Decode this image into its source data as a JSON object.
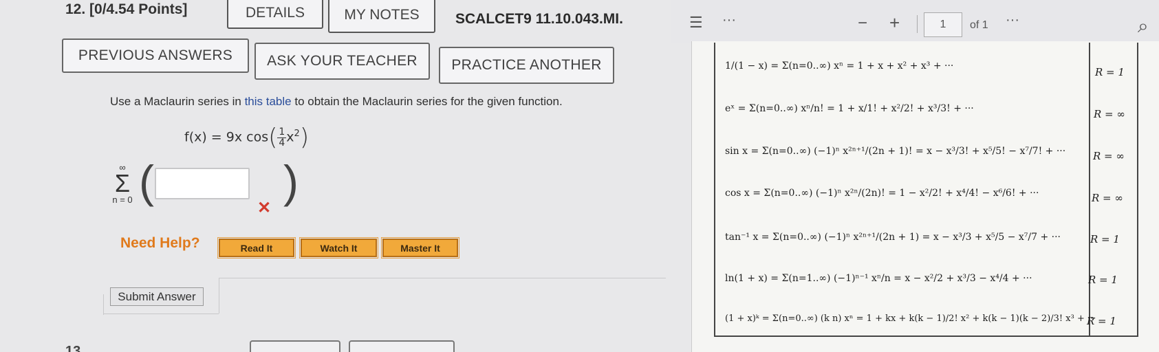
{
  "question": {
    "number_points": "12. [0/4.54 Points]",
    "id": "SCALCET9 11.10.043.MI.",
    "prompt_pre": "Use a Maclaurin series in ",
    "prompt_link": "this table",
    "prompt_post": " to obtain the Maclaurin series for the given function.",
    "function_lhs": "f(x) = 9x cos",
    "function_frac_num": "1",
    "function_frac_den": "4",
    "function_tail": "x",
    "function_exp": "2",
    "sum_upper": "∞",
    "sum_symbol": "Σ",
    "sum_lower": "n = 0",
    "answer_value": "",
    "wrong_mark": "✕"
  },
  "tabs": {
    "details": "DETAILS",
    "my_notes": "MY NOTES"
  },
  "actions": {
    "previous_answers": "PREVIOUS ANSWERS",
    "ask_teacher": "ASK YOUR TEACHER",
    "practice_another": "PRACTICE ANOTHER"
  },
  "help": {
    "label": "Need Help?",
    "read_it": "Read It",
    "watch_it": "Watch It",
    "master_it": "Master It"
  },
  "submit_label": "Submit Answer",
  "viewer": {
    "list_icon": "☰",
    "more_left": "···",
    "zoom_out": "−",
    "zoom_in": "+",
    "page_current": "1",
    "page_total": "of 1",
    "more_right": "···",
    "search_icon": "⌕"
  },
  "series_table": [
    {
      "formula": "1/(1 − x) = Σ(n=0..∞) xⁿ = 1 + x + x² + x³ + ···",
      "radius": "R = 1"
    },
    {
      "formula": "eˣ = Σ(n=0..∞) xⁿ/n! = 1 + x/1! + x²/2! + x³/3! + ···",
      "radius": "R = ∞"
    },
    {
      "formula": "sin x = Σ(n=0..∞) (−1)ⁿ x²ⁿ⁺¹/(2n + 1)! = x − x³/3! + x⁵/5! − x⁷/7! + ···",
      "radius": "R = ∞"
    },
    {
      "formula": "cos x = Σ(n=0..∞) (−1)ⁿ x²ⁿ/(2n)! = 1 − x²/2! + x⁴/4! − x⁶/6! + ···",
      "radius": "R = ∞"
    },
    {
      "formula": "tan⁻¹ x = Σ(n=0..∞) (−1)ⁿ x²ⁿ⁺¹/(2n + 1) = x − x³/3 + x⁵/5 − x⁷/7 + ···",
      "radius": "R = 1"
    },
    {
      "formula": "ln(1 + x) = Σ(n=1..∞) (−1)ⁿ⁻¹ xⁿ/n = x − x²/2 + x³/3 − x⁴/4 + ···",
      "radius": "R = 1"
    },
    {
      "formula": "(1 + x)ᵏ = Σ(n=0..∞) (k n) xⁿ = 1 + kx + k(k − 1)/2! x² + k(k − 1)(k − 2)/3! x³ + ···",
      "radius": "R = 1"
    }
  ],
  "bottom_question": "13."
}
